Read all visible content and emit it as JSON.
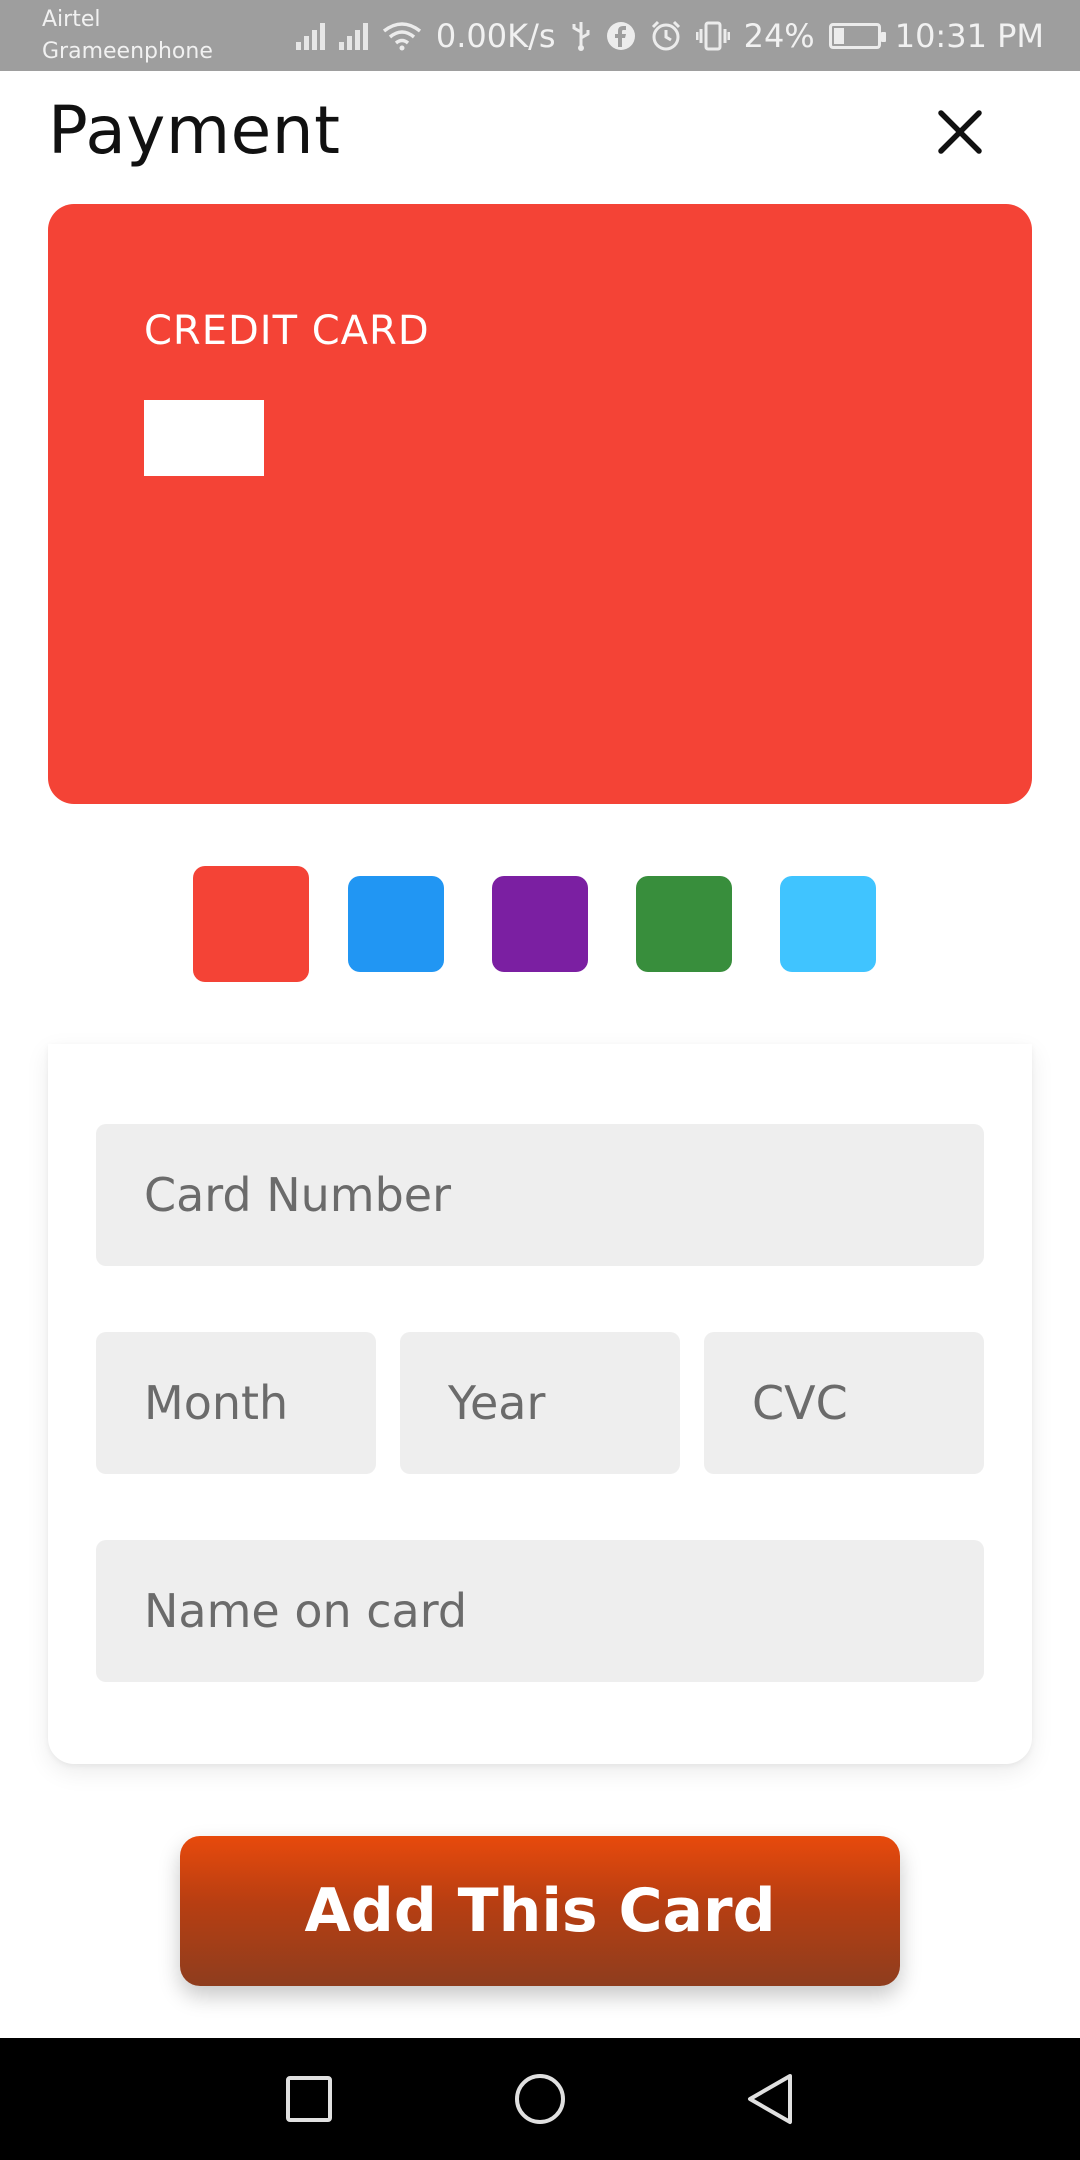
{
  "status_bar": {
    "carrier_primary": "Airtel",
    "carrier_secondary": "Grameenphone",
    "network_speed": "0.00K/s",
    "battery_percent": "24%",
    "time": "10:31 PM",
    "battery_level": 0.24
  },
  "header": {
    "title": "Payment",
    "close_icon": "close-icon"
  },
  "card_preview": {
    "label": "CREDIT CARD",
    "color": "#f44336"
  },
  "swatches": {
    "colors": [
      "#f44336",
      "#2196f3",
      "#7b1fa2",
      "#388e3c",
      "#40c4ff"
    ],
    "selected_index": 0
  },
  "form": {
    "card_number_placeholder": "Card Number",
    "month_placeholder": "Month",
    "year_placeholder": "Year",
    "cvc_placeholder": "CVC",
    "name_placeholder": "Name on card"
  },
  "actions": {
    "add_card_label": "Add This Card",
    "accent_color": "#e84a0c"
  },
  "nav": {
    "recent_icon": "square-icon",
    "home_icon": "circle-icon",
    "back_icon": "triangle-back-icon"
  }
}
